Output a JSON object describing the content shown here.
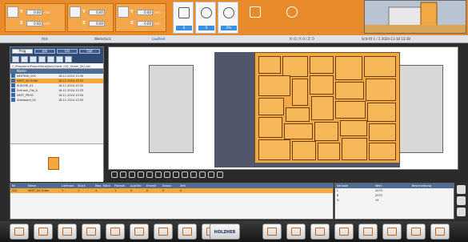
{
  "axes": [
    {
      "rows": [
        {
          "label": "Y",
          "value": "0.00",
          "unit": "mm"
        },
        {
          "label": "Z",
          "value": "0.00",
          "unit": "mm"
        }
      ]
    },
    {
      "rows": [
        {
          "label": "Y",
          "value": "0.00",
          "unit": "mm"
        },
        {
          "label": "Z",
          "value": "0.00",
          "unit": "mm"
        }
      ]
    },
    {
      "rows": [
        {
          "label": "Y",
          "value": "0.00",
          "unit": "mm"
        },
        {
          "label": "Z",
          "value": "0.00",
          "unit": "mm"
        }
      ]
    }
  ],
  "status_cells": [
    {
      "icon": "pressure-icon",
      "value": "0"
    },
    {
      "icon": "clock-icon",
      "value": "0"
    },
    {
      "icon": "speed-icon",
      "value": "0%"
    },
    {
      "icon": "spindle-icon",
      "value": ""
    },
    {
      "icon": "operator-icon",
      "value": ""
    }
  ],
  "status_bar": {
    "left": "AUs",
    "mid": "Werkstück",
    "mode": "Lauftext",
    "coords": "X: 0 / Y: 0 / Z: 0",
    "right": "Schritt 1 / 1   2024-11-18 13:38"
  },
  "left_panel": {
    "tabs": [
      "Prog",
      "Job",
      "Lib",
      "Opt"
    ],
    "path": "C:\\Programs\\ProjectData\\Jobs\\Sheet_001_Sheet_002.job",
    "column_header": "Name",
    "files": [
      {
        "name": "NESTING_001",
        "date": "18.11.2024 13:30",
        "selected": false
      },
      {
        "name": "NEST_04 Order",
        "date": "18.11.2024 13:31",
        "selected": true
      },
      {
        "name": "KUECHE_01",
        "date": "18.11.2024 13:32",
        "selected": false
      },
      {
        "name": "Schrank_Ost_A",
        "date": "18.11.2024 13:33",
        "selected": false
      },
      {
        "name": "NEST_PROG",
        "date": "18.11.2024 13:34",
        "selected": false
      },
      {
        "name": "Sideboard_02",
        "date": "18.11.2024 13:35",
        "selected": false
      }
    ]
  },
  "job_table": {
    "headers": [
      "Nr",
      "Name",
      "Lieferant",
      "Stück",
      "Max. Stück",
      "Plattstk.",
      "Ausführ.",
      "Erstellt",
      "Status",
      "Zeit"
    ],
    "rows": [
      {
        "nr": "001",
        "name": "NEST_04 Order",
        "c1": "1",
        "c2": "1",
        "c3": "1",
        "c4": "1",
        "c5": "0",
        "c6": "0",
        "c7": "0",
        "c8": "0"
      }
    ]
  },
  "params": {
    "headers": [
      "Variable",
      "Wert",
      "Beschreibung"
    ],
    "rows": [
      {
        "k": "L",
        "v": "2070"
      },
      {
        "k": "B",
        "v": "2070"
      },
      {
        "k": "D",
        "v": "19"
      }
    ]
  },
  "dock": {
    "brand": "HOLZHER"
  }
}
